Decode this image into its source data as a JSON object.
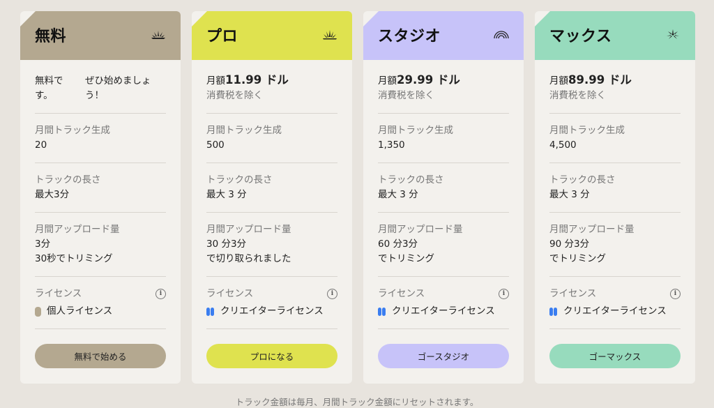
{
  "footer": "トラック金額は毎月、月間トラック金額にリセットされます。",
  "colors": {
    "free": "#b4a890",
    "pro": "#dfe24f",
    "studio": "#c7c3f9",
    "max": "#97dbbd"
  },
  "plans": [
    {
      "title": "無料",
      "icon": "half-sun-icon",
      "free_col1": "無料で す。",
      "free_col2": "ぜひ始めましょう！",
      "tracks_label": "月間トラック生成",
      "tracks_value": "20",
      "length_label": "トラックの長さ",
      "length_value": "最大3分",
      "upload_label": "月間アップロード量",
      "upload_line1": "3分",
      "upload_line2": "30秒でトリミング",
      "license_label": "ライセンス",
      "license_value": "個人ライセンス",
      "cta": "無料で始める"
    },
    {
      "title": "プロ",
      "icon": "sunburst-icon",
      "price_prefix": "月額",
      "price": "11.99 ドル",
      "tax": "消費税を除く",
      "tracks_label": "月間トラック生成",
      "tracks_value": "500",
      "length_label": "トラックの長さ",
      "length_value": "最大 3 分",
      "upload_label": "月間アップロード量",
      "upload_line1": "30 分3分",
      "upload_line2": "で切り取られました",
      "license_label": "ライセンス",
      "license_value": "クリエイターライセンス",
      "cta": "プロになる"
    },
    {
      "title": "スタジオ",
      "icon": "rainbow-icon",
      "price_prefix": "月額",
      "price": "29.99 ドル",
      "tax": "消費税を除く",
      "tracks_label": "月間トラック生成",
      "tracks_value": "1,350",
      "length_label": "トラックの長さ",
      "length_value": "最大 3 分",
      "upload_label": "月間アップロード量",
      "upload_line1": "60 分3分",
      "upload_line2": "でトリミング",
      "license_label": "ライセンス",
      "license_value": "クリエイターライセンス",
      "cta": "ゴースタジオ"
    },
    {
      "title": "マックス",
      "icon": "burst-icon",
      "price_prefix": "月額",
      "price": "89.99 ドル",
      "tax": "消費税を除く",
      "tracks_label": "月間トラック生成",
      "tracks_value": "4,500",
      "length_label": "トラックの長さ",
      "length_value": "最大 3 分",
      "upload_label": "月間アップロード量",
      "upload_line1": "90 分3分",
      "upload_line2": "でトリミング",
      "license_label": "ライセンス",
      "license_value": "クリエイターライセンス",
      "cta": "ゴーマックス"
    }
  ]
}
